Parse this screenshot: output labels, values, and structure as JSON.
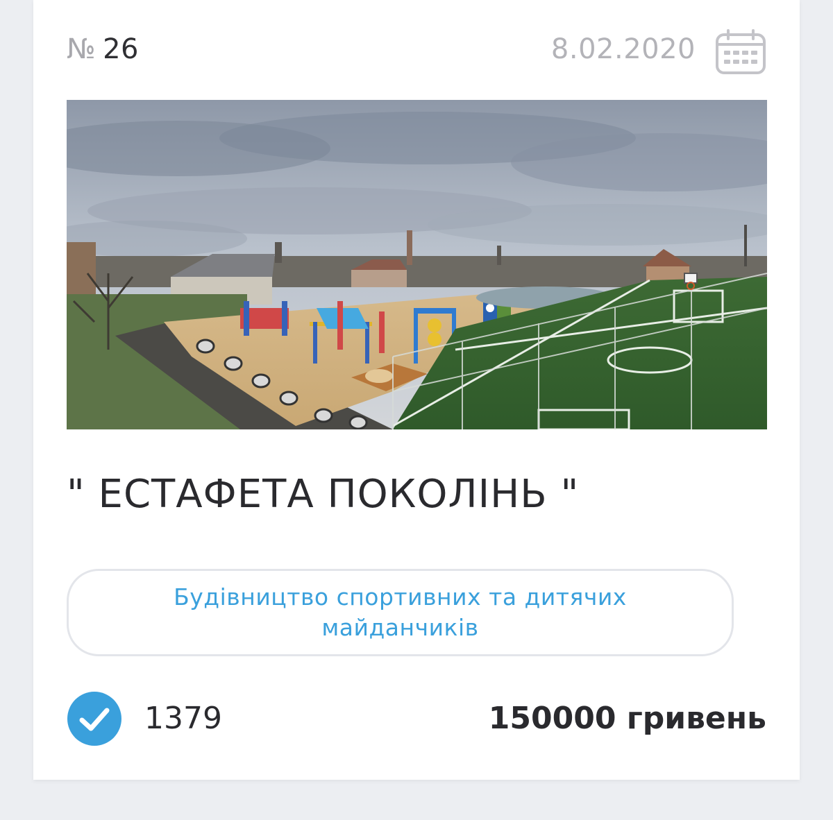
{
  "header": {
    "number_sign": "№",
    "number": "26",
    "date": "8.02.2020",
    "date_icon": "calendar-icon"
  },
  "project": {
    "image_alt": "Проєкт спортивного та дитячого майданчика",
    "title": "\" ЕСТАФЕТА ПОКОЛІНЬ \"",
    "category": "Будівництво спортивних та дитячих майданчиків"
  },
  "footer": {
    "vote_icon": "checkmark-icon",
    "votes": "1379",
    "budget": "150000 гривень"
  },
  "colors": {
    "accent": "#3aa0dc",
    "text_dark": "#2a2a2e",
    "text_muted": "#b3b3b8",
    "card_bg": "#ffffff",
    "page_bg": "#eceef2"
  }
}
